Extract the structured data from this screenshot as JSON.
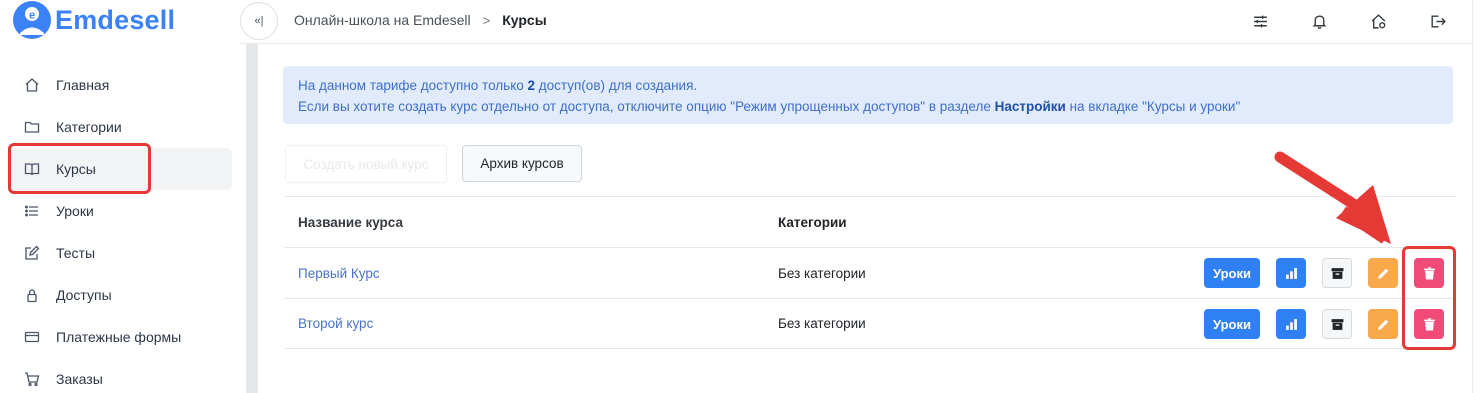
{
  "app": {
    "logo_text": "Emdesell"
  },
  "sidebar": {
    "items": [
      {
        "label": "Главная",
        "icon": "home-icon"
      },
      {
        "label": "Категории",
        "icon": "folder-icon"
      },
      {
        "label": "Курсы",
        "icon": "book-icon",
        "active": true
      },
      {
        "label": "Уроки",
        "icon": "list-icon"
      },
      {
        "label": "Тесты",
        "icon": "edit-icon"
      },
      {
        "label": "Доступы",
        "icon": "lock-icon"
      },
      {
        "label": "Платежные формы",
        "icon": "credit-card-icon"
      },
      {
        "label": "Заказы",
        "icon": "cart-icon"
      }
    ]
  },
  "header": {
    "collapse_label": "«|",
    "breadcrumb": {
      "root": "Онлайн-школа на Emdesell",
      "separator": ">",
      "current": "Курсы"
    },
    "icons": [
      "sliders-icon",
      "bell-icon",
      "home-settings-icon",
      "logout-icon"
    ]
  },
  "alert": {
    "line1_prefix": "На данном тарифе доступно только ",
    "line1_count": "2",
    "line1_suffix": " доступ(ов) для создания.",
    "line2_prefix": "Если вы хотите создать курс отдельно от доступа, отключите опцию \"Режим упрощенных доступов\" в разделе ",
    "line2_bold": "Настройки",
    "line2_suffix": " на вкладке \"Курсы и уроки\""
  },
  "buttons": {
    "create_course": "Создать новый курс",
    "archive": "Архив курсов"
  },
  "table": {
    "headers": {
      "name": "Название курса",
      "category": "Категории"
    },
    "rows": [
      {
        "name": "Первый Курс",
        "category": "Без категории",
        "lessons_label": "Уроки"
      },
      {
        "name": "Второй курс",
        "category": "Без категории",
        "lessons_label": "Уроки"
      }
    ]
  },
  "colors": {
    "brand": "#3b82f6",
    "primary": "#2f7ff5",
    "warning": "#f7a94c",
    "danger": "#ef4a78",
    "annotation": "#e53935"
  }
}
